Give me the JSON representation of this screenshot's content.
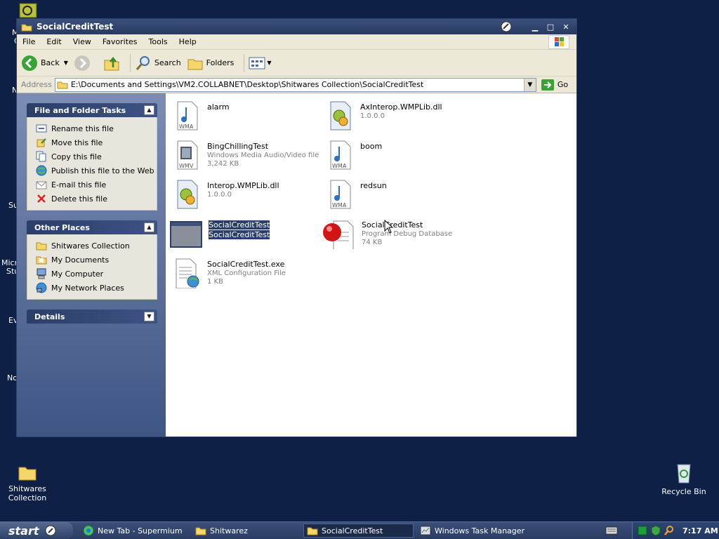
{
  "desktop": {
    "icons": [
      {
        "label": "Shitwares Collection"
      },
      {
        "label": "Recycle Bin"
      }
    ],
    "partial_labels": [
      "M",
      "C",
      "N",
      "Su",
      "Micro",
      "Stu",
      "Ev",
      "No"
    ]
  },
  "window": {
    "title": "SocialCreditTest",
    "menu": [
      "File",
      "Edit",
      "View",
      "Favorites",
      "Tools",
      "Help"
    ],
    "toolbar": {
      "back": "Back",
      "search": "Search",
      "folders": "Folders"
    },
    "address": {
      "label": "Address",
      "value": "E:\\Documents and Settings\\VM2.COLLABNET\\Desktop\\Shitwares Collection\\SocialCreditTest",
      "go": "Go"
    }
  },
  "sidebar": {
    "tasks": {
      "title": "File and Folder Tasks",
      "items": [
        "Rename this file",
        "Move this file",
        "Copy this file",
        "Publish this file to the Web",
        "E-mail this file",
        "Delete this file"
      ]
    },
    "other": {
      "title": "Other Places",
      "items": [
        "Shitwares Collection",
        "My Documents",
        "My Computer",
        "My Network Places"
      ]
    },
    "details": {
      "title": "Details"
    }
  },
  "files": [
    {
      "name": "alarm",
      "line2": "",
      "line3": "",
      "icon": "wma-icon"
    },
    {
      "name": "AxInterop.WMPLib.dll",
      "line2": "1.0.0.0",
      "line3": "",
      "icon": "dll-icon"
    },
    {
      "name": "BingChillingTest",
      "line2": "Windows Media Audio/Video file",
      "line3": "3,242 KB",
      "icon": "wmv-icon"
    },
    {
      "name": "boom",
      "line2": "",
      "line3": "",
      "icon": "wma-icon"
    },
    {
      "name": "Interop.WMPLib.dll",
      "line2": "1.0.0.0",
      "line3": "",
      "icon": "dll-icon"
    },
    {
      "name": "redsun",
      "line2": "",
      "line3": "",
      "icon": "wma-icon"
    },
    {
      "name": "SocialCreditTest",
      "line2": "SocialCreditTest",
      "line3": "",
      "icon": "exe-icon"
    },
    {
      "name": "SocialCreditTest",
      "line2": "Program Debug Database",
      "line3": "74 KB",
      "icon": "pdb-icon"
    },
    {
      "name": "SocialCreditTest.exe",
      "line2": "XML Configuration File",
      "line3": "1 KB",
      "icon": "config-icon"
    }
  ],
  "taskbar": {
    "start": "start",
    "tasks": [
      "New Tab - Supermium",
      "Shitwarez",
      "SocialCreditTest",
      "Windows Task Manager"
    ],
    "clock": "7:17 AM"
  }
}
